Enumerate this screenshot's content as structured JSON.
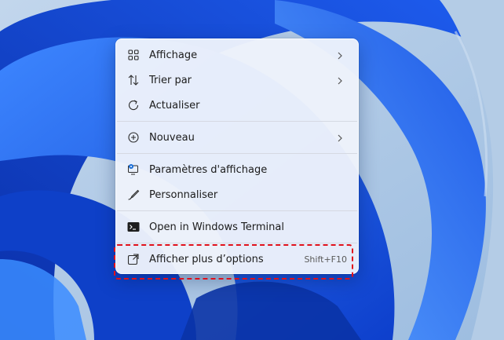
{
  "wallpaper": {
    "name": "Windows 11 bloom",
    "colors": {
      "sky": "#a9c7e6",
      "bloom": "#1a5ae8",
      "bloom_dark": "#0b36b8",
      "bloom_light": "#4f9bff"
    }
  },
  "context_menu": {
    "items": [
      {
        "label": "Affichage",
        "icon": "grid-icon",
        "submenu": true
      },
      {
        "label": "Trier par",
        "icon": "sort-icon",
        "submenu": true
      },
      {
        "label": "Actualiser",
        "icon": "refresh-icon",
        "submenu": false
      },
      {
        "label": "Nouveau",
        "icon": "plus-circle-icon",
        "submenu": true
      },
      {
        "label": "Paramètres d'affichage",
        "icon": "display-settings-icon",
        "submenu": false
      },
      {
        "label": "Personnaliser",
        "icon": "brush-icon",
        "submenu": false
      },
      {
        "label": "Open in Windows Terminal",
        "icon": "terminal-icon",
        "submenu": false
      },
      {
        "label": "Afficher plus d’options",
        "icon": "expand-icon",
        "submenu": false,
        "shortcut": "Shift+F10"
      }
    ]
  },
  "annotation": {
    "highlight_color": "#e0101a",
    "target": "Afficher plus d’options"
  }
}
